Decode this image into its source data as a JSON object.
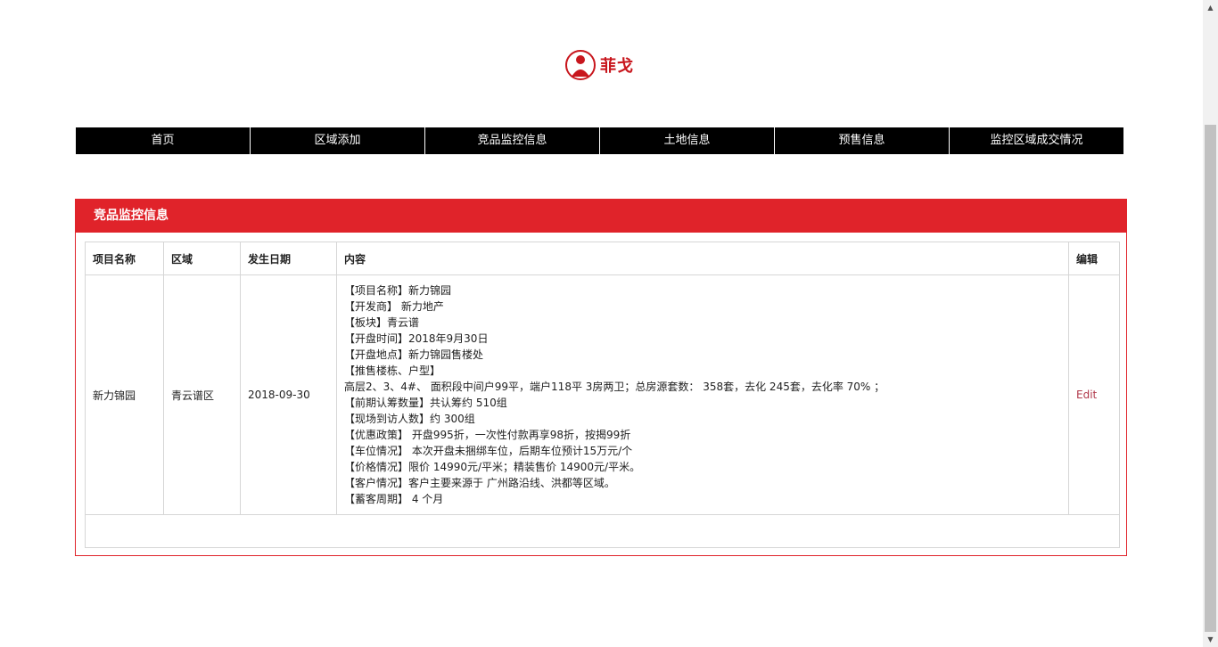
{
  "logo": {
    "text": "菲戈"
  },
  "nav": {
    "items": [
      "首页",
      "区域添加",
      "竞品监控信息",
      "土地信息",
      "预售信息",
      "监控区域成交情况"
    ]
  },
  "panel": {
    "title": "竞品监控信息",
    "columns": [
      "项目名称",
      "区域",
      "发生日期",
      "内容",
      "编辑"
    ],
    "row": {
      "project": "新力锦园",
      "region": "青云谱区",
      "date": "2018-09-30",
      "content_lines": [
        "【项目名称】新力锦园",
        "【开发商】 新力地产",
        "【板块】青云谱",
        "【开盘时间】2018年9月30日",
        "【开盘地点】新力锦园售楼处",
        "【推售楼栋、户型】",
        "高层2、3、4#、 面积段中间户99平，端户118平 3房两卫；总房源套数： 358套，去化 245套，去化率 70% ；",
        "【前期认筹数量】共认筹约 510组",
        "【现场到访人数】约 300组",
        "【优惠政策】 开盘995折，一次性付款再享98折，按揭99折",
        "【车位情况】 本次开盘未捆绑车位，后期车位预计15万元/个",
        "【价格情况】限价 14990元/平米；精装售价 14900元/平米。",
        "【客户情况】客户主要来源于 广州路沿线、洪都等区域。",
        "【蓄客周期】 4 个月"
      ],
      "edit": "Edit"
    }
  },
  "colors": {
    "accent": "#e0232a",
    "nav_bg": "#000000",
    "edit_link": "#b0384a"
  }
}
